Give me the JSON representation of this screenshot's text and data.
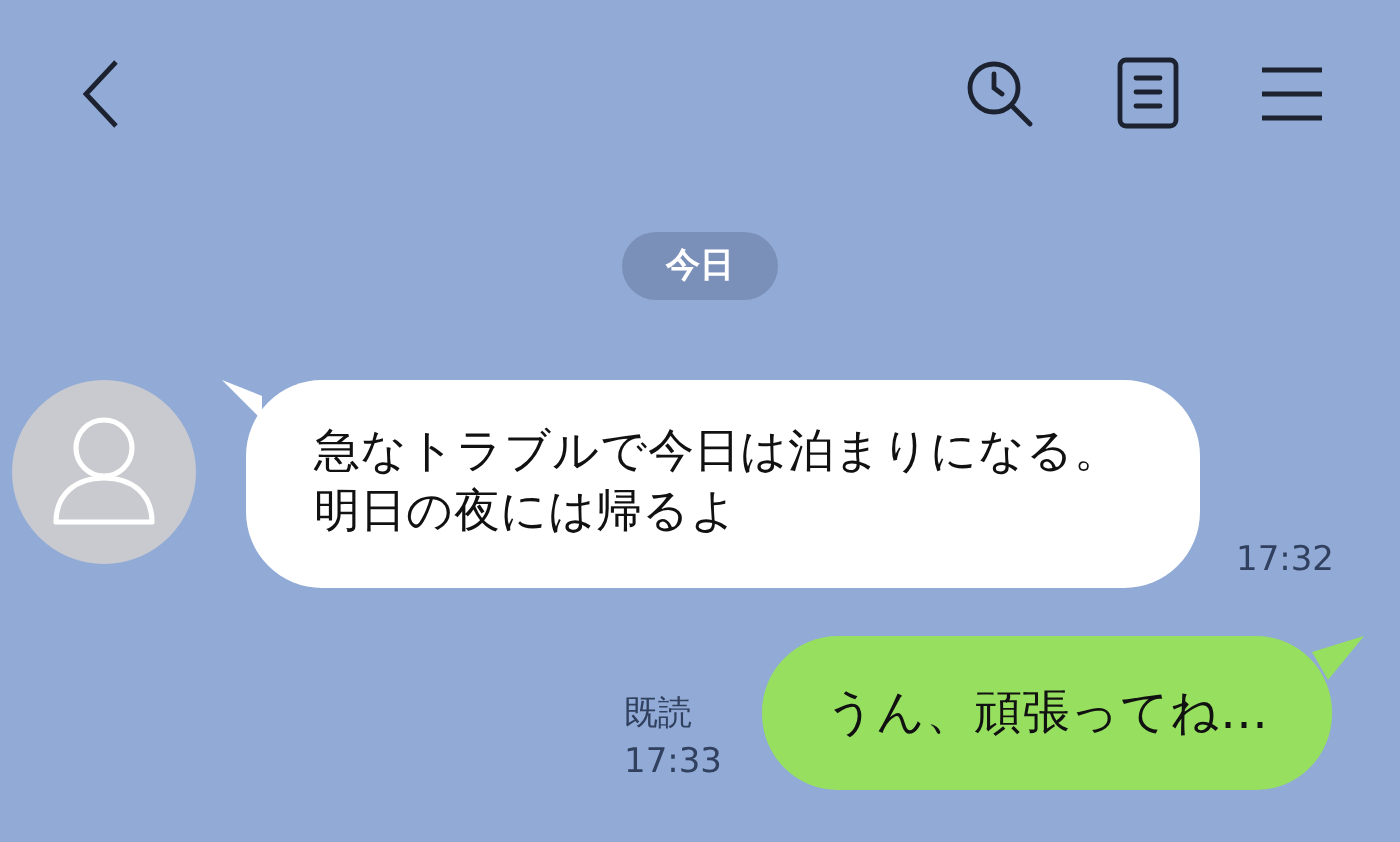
{
  "header": {
    "actions": [
      {
        "kind": "history"
      },
      {
        "kind": "notes"
      },
      {
        "kind": "menu"
      }
    ]
  },
  "date_separator": "今日",
  "messages": [
    {
      "kind": "received",
      "lines": [
        "急なトラブルで今日は泊まりになる。",
        "明日の夜には帰るよ"
      ],
      "time": "17:32"
    },
    {
      "kind": "sent",
      "text": "うん、頑張ってね…",
      "read_label": "既読",
      "time": "17:33"
    }
  ]
}
